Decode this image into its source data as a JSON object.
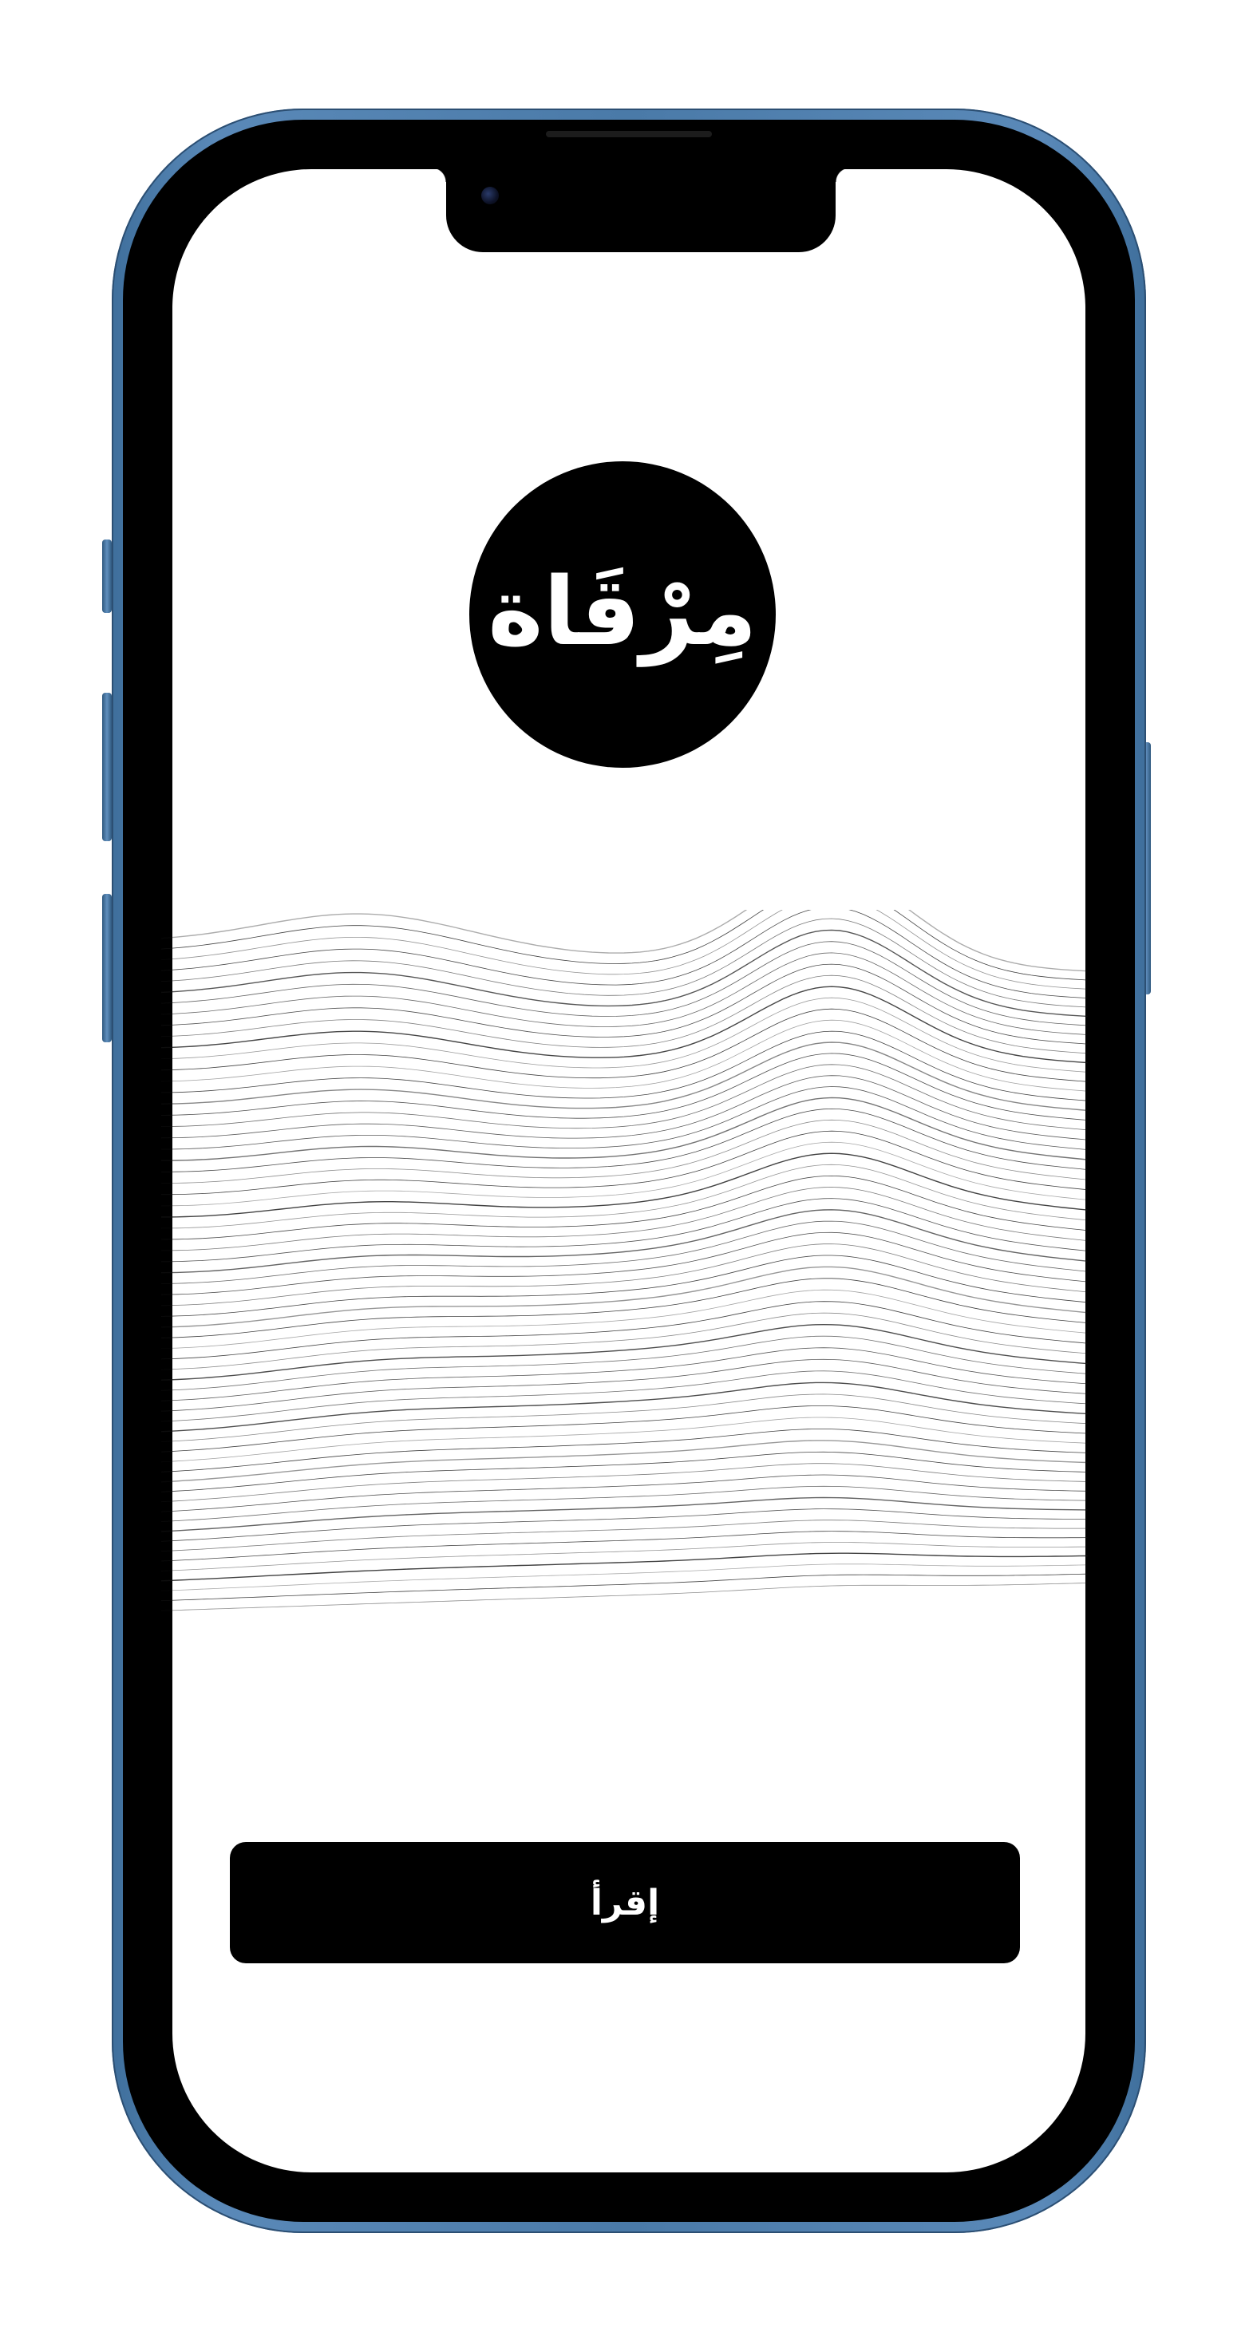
{
  "app": {
    "logo_text": "مِرْقَاة",
    "primary_button_label": "إقرأ"
  },
  "colors": {
    "frame": "#4a7aa8",
    "bezel": "#000000",
    "screen_bg": "#ffffff",
    "logo_bg": "#000000",
    "logo_text": "#ffffff",
    "button_bg": "#000000",
    "button_text": "#ffffff",
    "wave_stroke": "#111111"
  },
  "icons": {
    "front_camera": "camera-dot-icon",
    "earpiece": "speaker-grille"
  }
}
